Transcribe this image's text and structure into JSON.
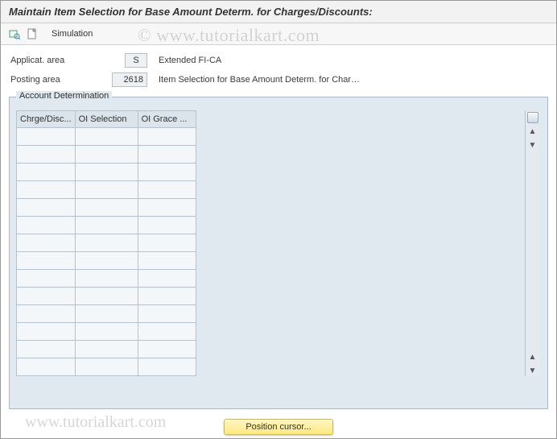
{
  "title": "Maintain Item Selection for Base Amount Determ. for Charges/Discounts:",
  "toolbar": {
    "simulation_label": "Simulation"
  },
  "header": {
    "applicat_area_label": "Applicat. area",
    "applicat_area_value": "S",
    "applicat_area_desc": "Extended FI-CA",
    "posting_area_label": "Posting area",
    "posting_area_value": "2618",
    "posting_area_desc": "Item Selection for Base Amount Determ. for Char…"
  },
  "panel": {
    "title": "Account Determination",
    "columns": [
      "Chrge/Disc...",
      "OI Selection",
      "OI Grace ..."
    ],
    "rows": [
      [
        "",
        "",
        ""
      ],
      [
        "",
        "",
        ""
      ],
      [
        "",
        "",
        ""
      ],
      [
        "",
        "",
        ""
      ],
      [
        "",
        "",
        ""
      ],
      [
        "",
        "",
        ""
      ],
      [
        "",
        "",
        ""
      ],
      [
        "",
        "",
        ""
      ],
      [
        "",
        "",
        ""
      ],
      [
        "",
        "",
        ""
      ],
      [
        "",
        "",
        ""
      ],
      [
        "",
        "",
        ""
      ],
      [
        "",
        "",
        ""
      ],
      [
        "",
        "",
        ""
      ]
    ]
  },
  "footer": {
    "position_cursor_label": "Position cursor..."
  },
  "watermark": "© www.tutorialkart.com",
  "watermark2": "www.tutorialkart.com"
}
